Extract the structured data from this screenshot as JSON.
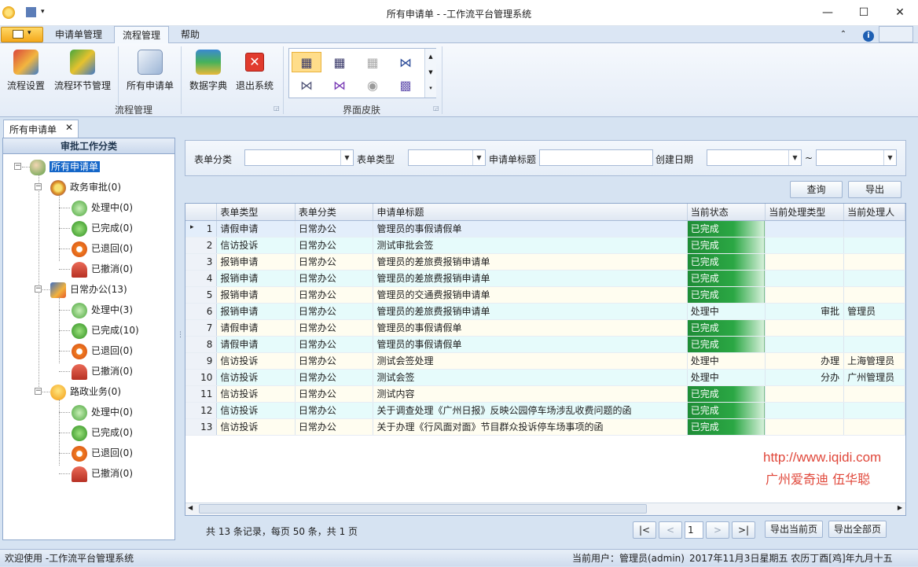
{
  "window": {
    "title": "所有申请单 - -工作流平台管理系统",
    "min": "—",
    "max": "☐",
    "close": "✕"
  },
  "ribbon_tabs": [
    "申请单管理",
    "流程管理",
    "帮助"
  ],
  "ribbon": {
    "buttons": [
      "流程设置",
      "流程环节管理",
      "所有申请单",
      "数据字典",
      "退出系统"
    ],
    "group_flow": "流程管理",
    "group_skin": "界面皮肤"
  },
  "doc_tab": {
    "label": "所有申请单",
    "close": "✕"
  },
  "tree": {
    "header": "审批工作分类",
    "root": "所有申请单",
    "groups": [
      {
        "label": "政务审批(0)",
        "children": [
          "处理中(0)",
          "已完成(0)",
          "已退回(0)",
          "已撤消(0)"
        ]
      },
      {
        "label": "日常办公(13)",
        "children": [
          "处理中(3)",
          "已完成(10)",
          "已退回(0)",
          "已撤消(0)"
        ]
      },
      {
        "label": "路政业务(0)",
        "children": [
          "处理中(0)",
          "已完成(0)",
          "已退回(0)",
          "已撤消(0)"
        ]
      }
    ]
  },
  "filter": {
    "form_category": "表单分类",
    "form_type": "表单类型",
    "title_label": "申请单标题",
    "created_label": "创建日期",
    "range_sep": "~",
    "query": "查询",
    "export": "导出"
  },
  "grid": {
    "columns": [
      "表单类型",
      "表单分类",
      "申请单标题",
      "当前状态",
      "当前处理类型",
      "当前处理人"
    ],
    "rows": [
      {
        "n": "1",
        "type": "请假申请",
        "cat": "日常办公",
        "title": "管理员的事假请假单",
        "status": "已完成",
        "ptype": "",
        "person": ""
      },
      {
        "n": "2",
        "type": "信访投诉",
        "cat": "日常办公",
        "title": "测试审批会签",
        "status": "已完成",
        "ptype": "",
        "person": ""
      },
      {
        "n": "3",
        "type": "报销申请",
        "cat": "日常办公",
        "title": "管理员的差旅费报销申请单",
        "status": "已完成",
        "ptype": "",
        "person": ""
      },
      {
        "n": "4",
        "type": "报销申请",
        "cat": "日常办公",
        "title": "管理员的差旅费报销申请单",
        "status": "已完成",
        "ptype": "",
        "person": ""
      },
      {
        "n": "5",
        "type": "报销申请",
        "cat": "日常办公",
        "title": "管理员的交通费报销申请单",
        "status": "已完成",
        "ptype": "",
        "person": ""
      },
      {
        "n": "6",
        "type": "报销申请",
        "cat": "日常办公",
        "title": "管理员的差旅费报销申请单",
        "status": "处理中",
        "ptype": "审批",
        "person": "管理员"
      },
      {
        "n": "7",
        "type": "请假申请",
        "cat": "日常办公",
        "title": "管理员的事假请假单",
        "status": "已完成",
        "ptype": "",
        "person": ""
      },
      {
        "n": "8",
        "type": "请假申请",
        "cat": "日常办公",
        "title": "管理员的事假请假单",
        "status": "已完成",
        "ptype": "",
        "person": ""
      },
      {
        "n": "9",
        "type": "信访投诉",
        "cat": "日常办公",
        "title": "测试会签处理",
        "status": "处理中",
        "ptype": "办理",
        "person": "上海管理员"
      },
      {
        "n": "10",
        "type": "信访投诉",
        "cat": "日常办公",
        "title": "测试会签",
        "status": "处理中",
        "ptype": "分办",
        "person": "广州管理员"
      },
      {
        "n": "11",
        "type": "信访投诉",
        "cat": "日常办公",
        "title": "测试内容",
        "status": "已完成",
        "ptype": "",
        "person": ""
      },
      {
        "n": "12",
        "type": "信访投诉",
        "cat": "日常办公",
        "title": "关于调查处理《广州日报》反映公园停车场涉乱收费问题的函",
        "status": "已完成",
        "ptype": "",
        "person": ""
      },
      {
        "n": "13",
        "type": "信访投诉",
        "cat": "日常办公",
        "title": "关于办理《行风面对面》节目群众投诉停车场事项的函",
        "status": "已完成",
        "ptype": "",
        "person": ""
      }
    ]
  },
  "watermark": {
    "url": "http://www.iqidi.com",
    "name": "广州爱奇迪  伍华聪"
  },
  "pager": {
    "summary": "共 13 条记录，每页 50 条，共 1 页",
    "first": "|<",
    "prev": "<",
    "page": "1",
    "next": ">",
    "last": ">|",
    "export_page": "导出当前页",
    "export_all": "导出全部页"
  },
  "status": {
    "welcome": "欢迎使用 -工作流平台管理系统",
    "user": "当前用户：管理员(admin)",
    "date": "2017年11月3日星期五  农历丁酉[鸡]年九月十五"
  },
  "colors": {
    "done": "#2ba744",
    "accent": "#f4a81c",
    "watermark": "#e0473a"
  }
}
